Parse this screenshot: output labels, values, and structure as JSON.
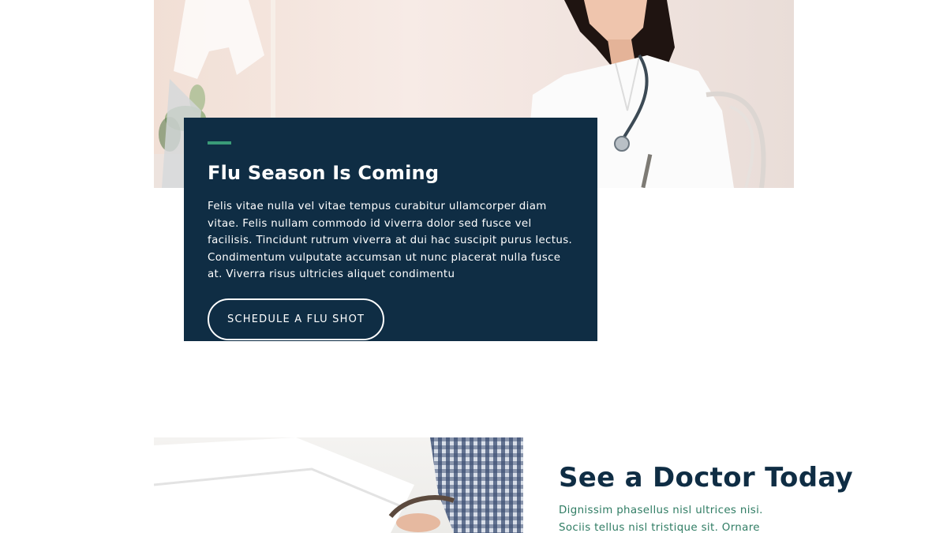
{
  "flu_section": {
    "title": "Flu Season Is Coming",
    "body": "Felis vitae nulla vel vitae tempus curabitur ullamcorper diam vitae. Felis nullam commodo id viverra dolor sed fusce vel facilisis. Tincidunt rutrum viverra at dui hac suscipit purus lectus. Condimentum vulputate accumsan ut nunc placerat nulla fusce at. Viverra risus ultricies aliquet condimentu",
    "button_label": "SCHEDULE A FLU SHOT"
  },
  "doctor_section": {
    "title": "See a Doctor Today",
    "body": "Dignissim phasellus nisl ultrices nisi. Sociis tellus nisl tristique sit. Ornare ullamcorper ut posuere"
  },
  "colors": {
    "card_background": "#0f2d44",
    "accent": "#3a9b78",
    "heading_dark": "#0f2d44",
    "body_green": "#2f7c63"
  }
}
